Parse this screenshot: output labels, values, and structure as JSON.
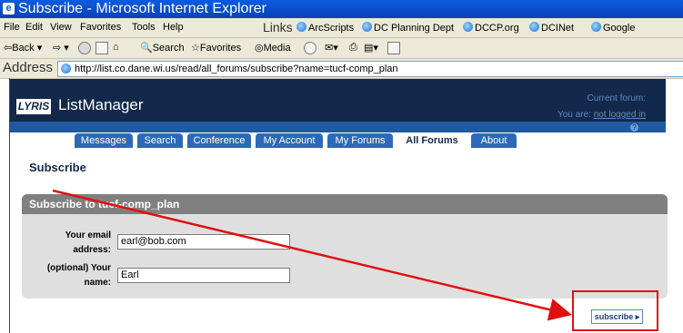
{
  "window": {
    "title": "Subscribe - Microsoft Internet Explorer"
  },
  "menu": [
    "File",
    "Edit",
    "View",
    "Favorites",
    "Tools",
    "Help"
  ],
  "links": {
    "label": "Links",
    "items": [
      "ArcScripts",
      "DC Planning Dept",
      "DCCP.org",
      "DCINet",
      "Google"
    ]
  },
  "toolbar": {
    "back": "Back",
    "search": "Search",
    "favorites": "Favorites",
    "media": "Media"
  },
  "address": {
    "label": "Address",
    "url": "http://list.co.dane.wi.us/read/all_forums/subscribe?name=tucf-comp_plan"
  },
  "app": {
    "logo": "LYRIS",
    "name": "ListManager",
    "current_forum": "Current forum:",
    "you_are": "You are:",
    "login_status": "not logged in",
    "help": "?"
  },
  "nav": {
    "tabs": [
      "Messages",
      "Search",
      "Conference",
      "My Account",
      "My Forums",
      "All Forums",
      "About"
    ],
    "active": "All Forums"
  },
  "page": {
    "title": "Subscribe"
  },
  "form": {
    "panel_title": "Subscribe to tucf-comp_plan",
    "email_label_1": "Your email",
    "email_label_2": "address:",
    "email_value": "earl@bob.com",
    "name_label_1": "(optional) Your",
    "name_label_2": "name:",
    "name_value": "Earl",
    "submit_label": "subscribe",
    "submit_arrow": "▸"
  },
  "annotation": {
    "box_color": "#e01010",
    "arrow_color": "#e01010"
  }
}
